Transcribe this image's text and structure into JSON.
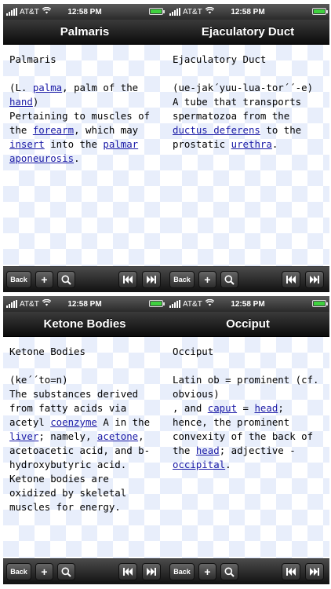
{
  "status": {
    "carrier": "AT&T",
    "time": "12:58 PM"
  },
  "toolbar": {
    "back_label": "Back",
    "add_label": "+"
  },
  "screens": [
    {
      "title": "Palmaris",
      "term": "Palmaris",
      "segments": [
        {
          "t": "(L. "
        },
        {
          "t": "palma",
          "link": true
        },
        {
          "t": ", palm of the "
        },
        {
          "t": "hand",
          "link": true
        },
        {
          "t": ")\nPertaining to muscles of the "
        },
        {
          "t": "forearm",
          "link": true
        },
        {
          "t": ", which may "
        },
        {
          "t": "insert",
          "link": true
        },
        {
          "t": " into the "
        },
        {
          "t": "palmar",
          "link": true
        },
        {
          "t": " "
        },
        {
          "t": "aponeurosis",
          "link": true
        },
        {
          "t": "."
        }
      ]
    },
    {
      "title": "Ejaculatory Duct",
      "term": "Ejaculatory Duct",
      "segments": [
        {
          "t": "(ue-jak´yuu-lua-tor´´-e)\nA tube that transports spermatozoa from the "
        },
        {
          "t": "ductus deferens",
          "link": true
        },
        {
          "t": " to the prostatic "
        },
        {
          "t": "urethra",
          "link": true
        },
        {
          "t": "."
        }
      ]
    },
    {
      "title": "Ketone Bodies",
      "term": "Ketone Bodies",
      "segments": [
        {
          "t": "(ke´´to=n)\nThe substances derived from fatty acids via acetyl "
        },
        {
          "t": "coenzyme",
          "link": true
        },
        {
          "t": " A in the "
        },
        {
          "t": "liver",
          "link": true
        },
        {
          "t": "; namely, "
        },
        {
          "t": "acetone",
          "link": true
        },
        {
          "t": ", acetoacetic acid, and b-hydroxybutyric acid. Ketone bodies are oxidized by skeletal muscles for energy."
        }
      ]
    },
    {
      "title": "Occiput",
      "term": "Occiput",
      "segments": [
        {
          "t": "Latin ob = prominent (cf. obvious)\n, and "
        },
        {
          "t": "caput",
          "link": true
        },
        {
          "t": " = "
        },
        {
          "t": "head",
          "link": true
        },
        {
          "t": "; hence, the prominent convexity of the back of the "
        },
        {
          "t": "head",
          "link": true
        },
        {
          "t": "; adjective - "
        },
        {
          "t": "occipital",
          "link": true
        },
        {
          "t": "."
        }
      ]
    }
  ],
  "colors": {
    "link": "#1a1aa6",
    "battery": "#3fd13f",
    "checker": "#e8eefb"
  },
  "icons": [
    "signal-icon",
    "wifi-icon",
    "battery-icon",
    "search-icon",
    "skip-back-icon",
    "skip-forward-icon"
  ]
}
